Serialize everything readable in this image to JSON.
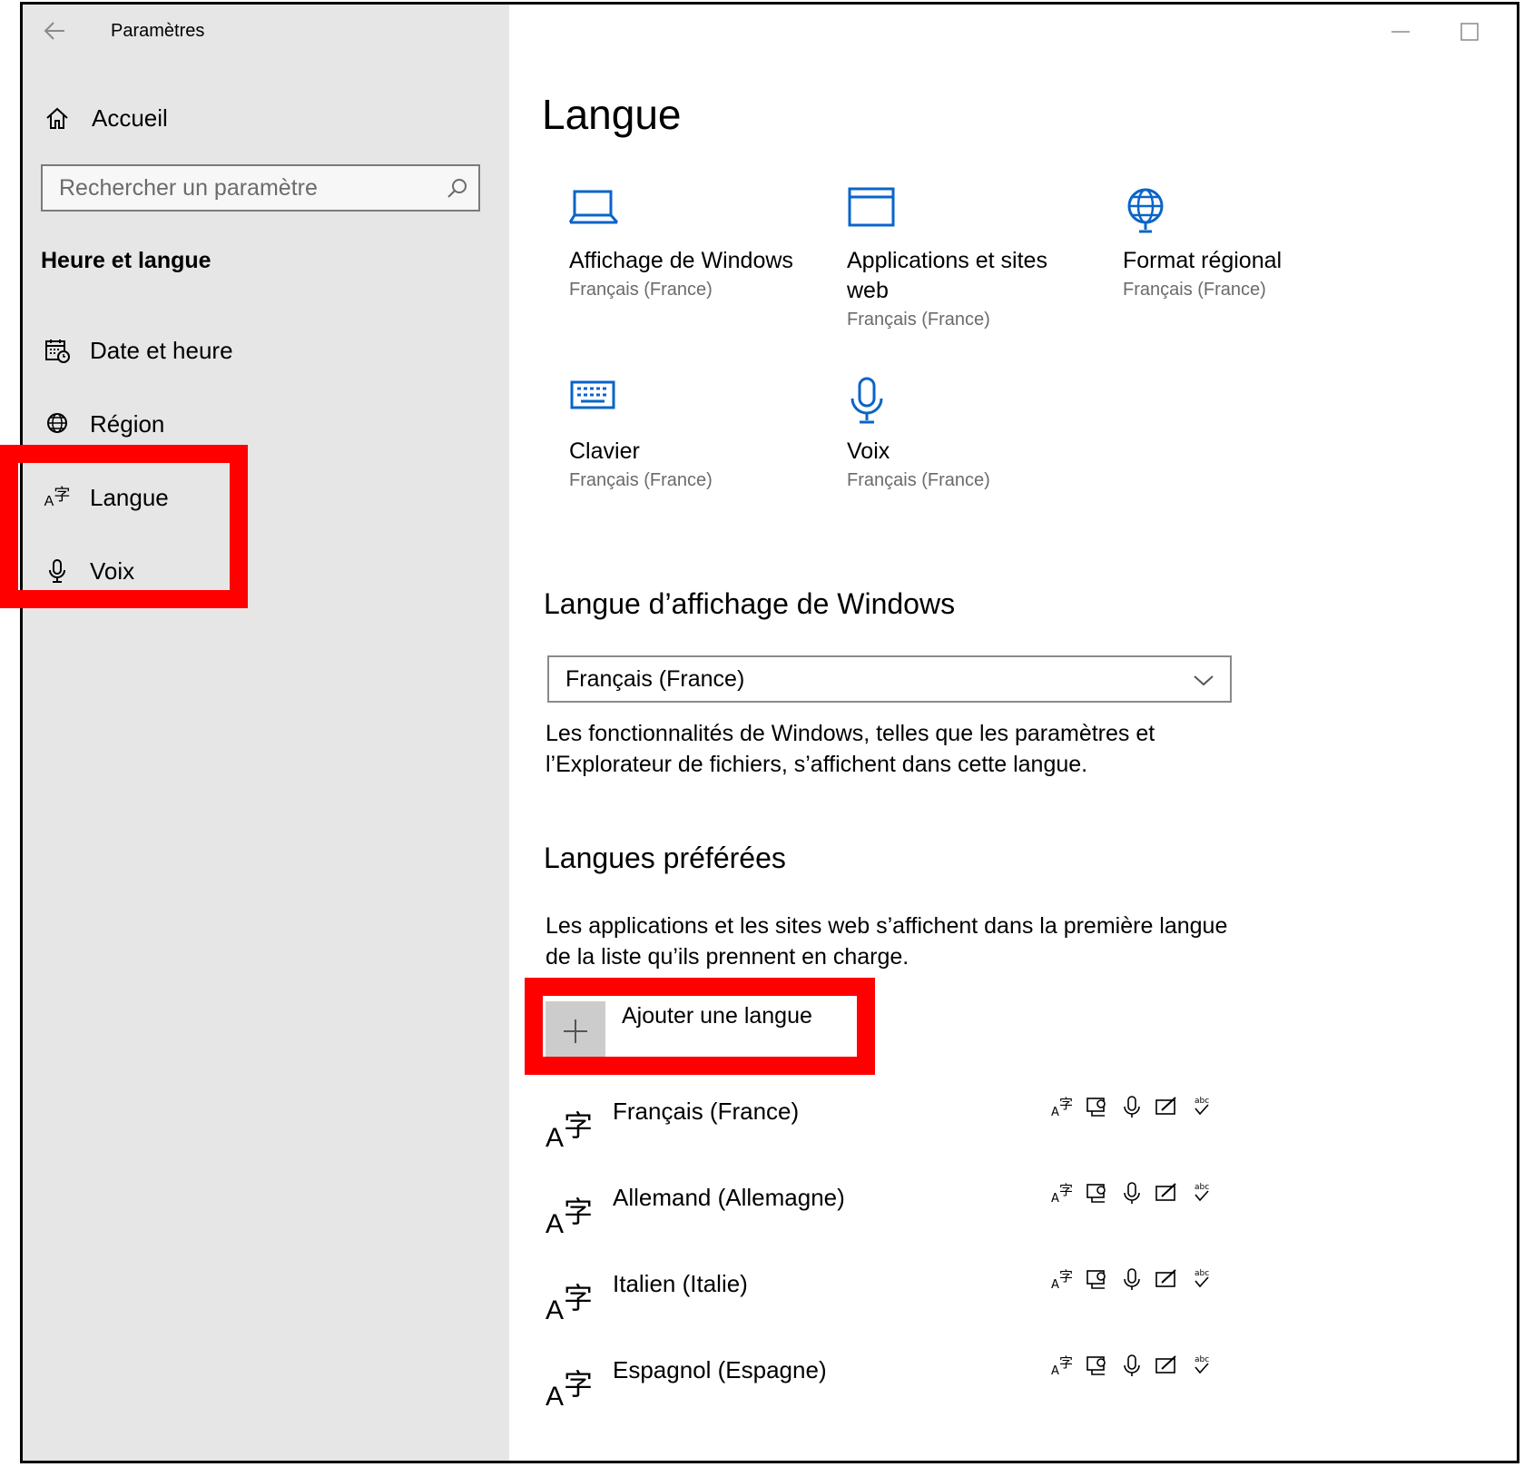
{
  "window": {
    "title": "Paramètres"
  },
  "sidebar": {
    "home": "Accueil",
    "search_placeholder": "Rechercher un paramètre",
    "section": "Heure et langue",
    "items": [
      {
        "label": "Date et heure",
        "icon": "calendar-clock-icon"
      },
      {
        "label": "Région",
        "icon": "globe-icon"
      },
      {
        "label": "Langue",
        "icon": "language-icon"
      },
      {
        "label": "Voix",
        "icon": "microphone-icon"
      }
    ]
  },
  "main": {
    "title": "Langue",
    "tiles": [
      {
        "name": "Affichage de Windows",
        "sub": "Français (France)",
        "icon": "laptop-icon"
      },
      {
        "name": "Applications et sites web",
        "sub": "Français (France)",
        "icon": "window-icon"
      },
      {
        "name": "Format régional",
        "sub": "Français (France)",
        "icon": "globe-icon"
      },
      {
        "name": "Clavier",
        "sub": "Français (France)",
        "icon": "keyboard-icon"
      },
      {
        "name": "Voix",
        "sub": "Français (France)",
        "icon": "microphone-icon"
      }
    ],
    "display_language": {
      "heading": "Langue d’affichage de Windows",
      "selected": "Français (France)",
      "description": "Les fonctionnalités de Windows, telles que les paramètres et l’Explorateur de fichiers, s’affichent dans cette langue."
    },
    "preferred": {
      "heading": "Langues préférées",
      "description": "Les applications et les sites web s’affichent dans la première langue de la liste qu’ils prennent en charge.",
      "add_label": "Ajouter une langue",
      "languages": [
        "Français (France)",
        "Allemand (Allemagne)",
        "Italien (Italie)",
        "Espagnol (Espagne)"
      ]
    }
  },
  "colors": {
    "accent": "#0a64c8",
    "highlight": "#ff0000",
    "sidebar_bg": "#e6e6e6"
  }
}
